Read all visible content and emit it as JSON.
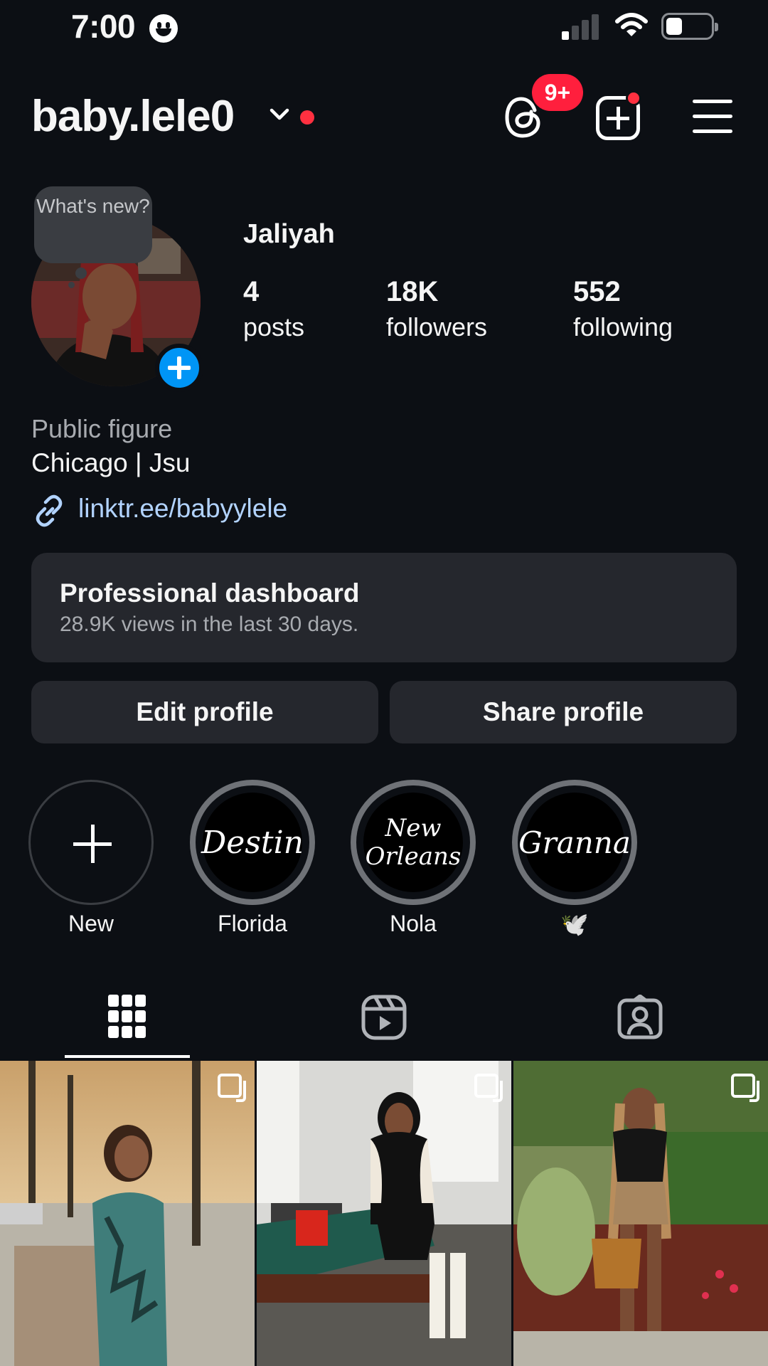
{
  "status_bar": {
    "time": "7:00"
  },
  "header": {
    "username": "baby.lele0",
    "threads_badge": "9+"
  },
  "profile": {
    "note": "What's new?",
    "display_name": "Jaliyah",
    "stats": [
      {
        "value": "4",
        "label": "posts"
      },
      {
        "value": "18K",
        "label": "followers"
      },
      {
        "value": "552",
        "label": "following"
      }
    ],
    "category": "Public figure",
    "bio": "Chicago | Jsu",
    "link": "linktr.ee/babyylele"
  },
  "dashboard": {
    "title": "Professional dashboard",
    "subtitle": "28.9K views in the last 30 days."
  },
  "buttons": {
    "edit": "Edit profile",
    "share": "Share profile"
  },
  "highlights": [
    {
      "cover": "",
      "label": "New"
    },
    {
      "cover": "Destin",
      "label": "Florida"
    },
    {
      "cover": "New Orleans",
      "label": "Nola"
    },
    {
      "cover": "Granna",
      "label": "🕊️"
    }
  ],
  "tabs": [
    "grid-icon",
    "reels-icon",
    "tagged-icon"
  ],
  "colors": {
    "background": "#0c0f14",
    "accent": "#0095f6",
    "notification": "#ff3040",
    "link": "#b2d3ff",
    "card": "#25272d"
  }
}
